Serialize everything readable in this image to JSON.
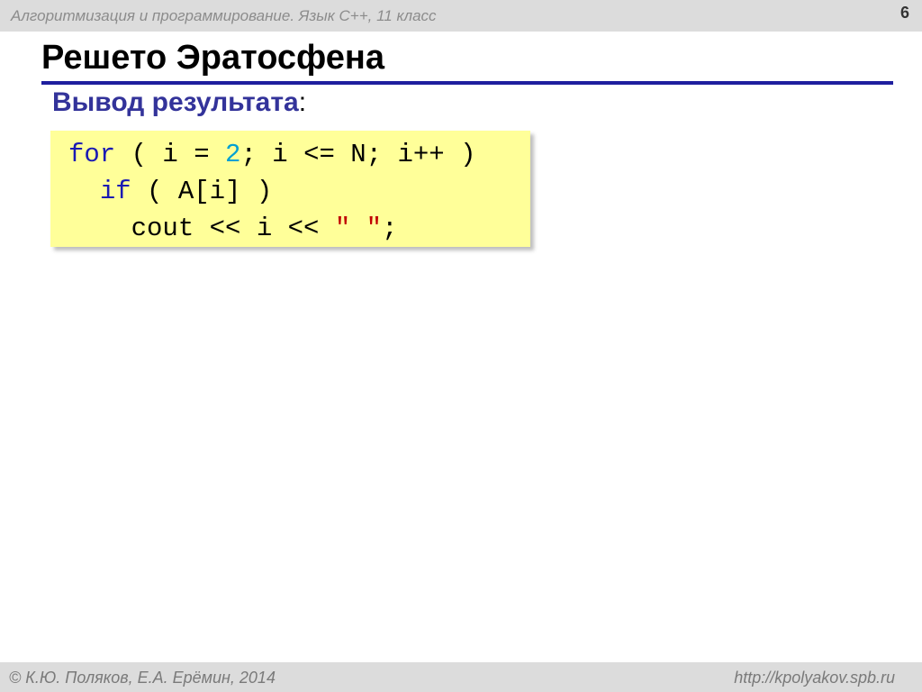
{
  "header": {
    "course_title": "Алгоритмизация и программирование. Язык С++, 11 класс",
    "page_number": "6"
  },
  "slide": {
    "title": "Решето Эратосфена",
    "subtitle": "Вывод результата",
    "subtitle_colon": ":"
  },
  "code": {
    "line1": {
      "kw": "for",
      "a": " ( i ",
      "op": "=",
      "num": "2",
      "b": "; i <= N; i++ )"
    },
    "line2": {
      "indent": "  ",
      "kw": "if",
      "rest": " ( A[i] )"
    },
    "line3": {
      "indent": "    ",
      "text": "cout << i << ",
      "str": "\" \"",
      "end": ";"
    }
  },
  "footer": {
    "authors": "© К.Ю. Поляков, Е.А. Ерёмин, 2014",
    "url": "http://kpolyakov.spb.ru"
  },
  "colors": {
    "keyword": "#1a1ab3",
    "number": "#00a0d2",
    "string": "#c00000",
    "code_background": "#ffff99",
    "title_rule": "#1f1f9e",
    "subtitle": "#33339a"
  }
}
